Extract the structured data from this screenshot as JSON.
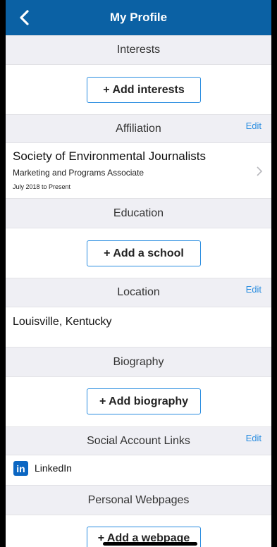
{
  "navbar": {
    "title": "My Profile"
  },
  "sections": {
    "interests": {
      "title": "Interests",
      "add_label": "+ Add interests"
    },
    "affiliation": {
      "title": "Affiliation",
      "edit_label": "Edit",
      "organization": "Society of Environmental Journalists",
      "role": "Marketing and Programs Associate",
      "dates": "July 2018 to Present"
    },
    "education": {
      "title": "Education",
      "add_label": "+ Add a school"
    },
    "location": {
      "title": "Location",
      "edit_label": "Edit",
      "value": "Louisville, Kentucky"
    },
    "biography": {
      "title": "Biography",
      "add_label": "+ Add biography"
    },
    "social": {
      "title": "Social Account Links",
      "edit_label": "Edit",
      "items": [
        {
          "icon": "linkedin-icon",
          "icon_text": "in",
          "label": "LinkedIn"
        }
      ]
    },
    "webpages": {
      "title": "Personal Webpages",
      "add_label": "+ Add a webpage"
    }
  },
  "colors": {
    "navbar": "#0b61a4",
    "accent": "#2a8de0",
    "section_bg": "#efeff4",
    "linkedin": "#0b66c2"
  }
}
